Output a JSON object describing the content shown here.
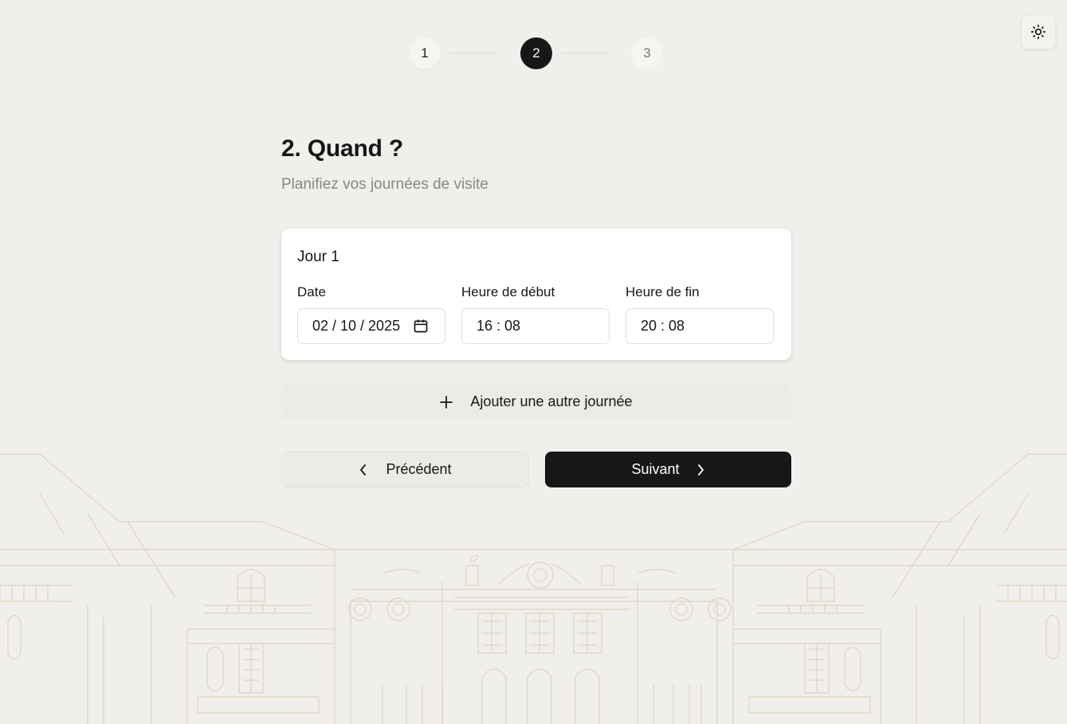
{
  "theme_toggle": {
    "icon": "sun-icon"
  },
  "stepper": {
    "steps": [
      {
        "label": "1",
        "state": "done"
      },
      {
        "label": "2",
        "state": "active"
      },
      {
        "label": "3",
        "state": "upcoming"
      }
    ]
  },
  "header": {
    "title": "2. Quand ?",
    "subtitle": "Planifiez vos journées de visite"
  },
  "day_card": {
    "title": "Jour 1",
    "date_label": "Date",
    "date_value": "02 / 10 / 2025",
    "start_label": "Heure de début",
    "start_value": "16 : 08",
    "end_label": "Heure de fin",
    "end_value": "20 : 08"
  },
  "add_day": {
    "label": "Ajouter une autre journée",
    "icon": "plus-icon"
  },
  "navigation": {
    "prev_label": "Précédent",
    "next_label": "Suivant"
  },
  "colors": {
    "background": "#f1efeb",
    "primary": "#171717",
    "illustration": "#ddd3c2"
  }
}
